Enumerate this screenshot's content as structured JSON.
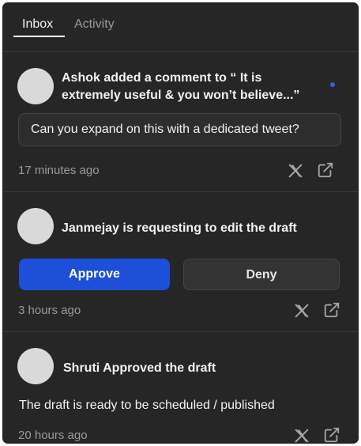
{
  "tabs": {
    "inbox": "Inbox",
    "activity": "Activity",
    "active": "Inbox"
  },
  "notifications": [
    {
      "title_line1": "Ashok added a comment to “ It is",
      "title_line2": "extremely useful & you won’t believe...”",
      "quote": "Can you expand on this with a dedicated tweet?",
      "time": "17 minutes ago",
      "unread": true
    },
    {
      "title": "Janmejay is requesting to edit the draft",
      "approve_label": "Approve",
      "deny_label": "Deny",
      "time": "3 hours ago"
    },
    {
      "title": "Shruti Approved the draft",
      "body": "The draft is ready to be scheduled / published",
      "time": "20 hours ago"
    }
  ],
  "icons": {
    "x": "x-logo-icon",
    "open": "external-link-icon"
  },
  "colors": {
    "panel_bg": "#262626",
    "accent_blue": "#1d4fd8",
    "unread_dot": "#2f63e0",
    "muted_text": "#9a9a9a"
  }
}
